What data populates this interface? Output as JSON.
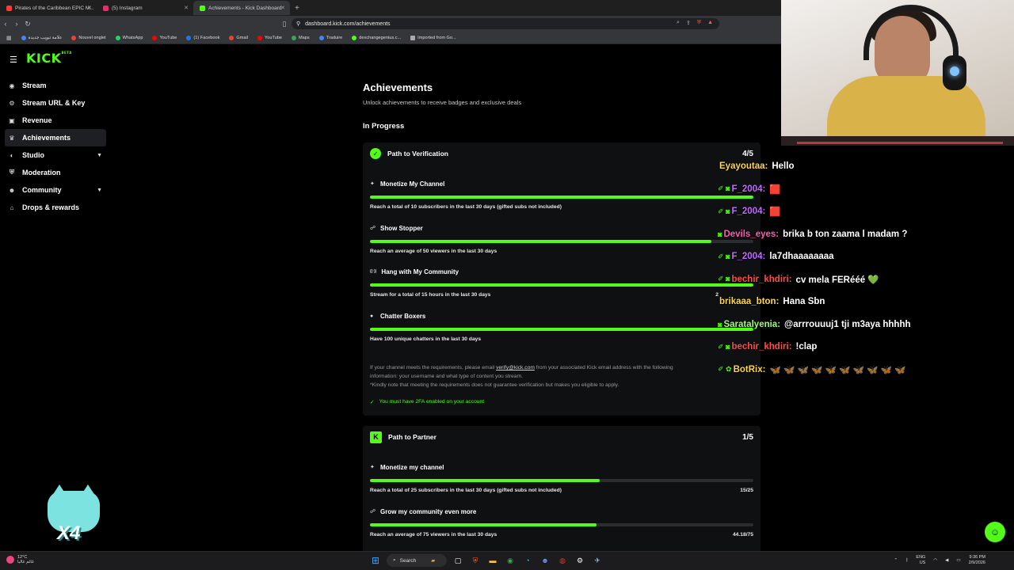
{
  "browser": {
    "tabs": [
      {
        "title": "Pirates of the Caribbean EPIC M...",
        "color": "#ff3b30"
      },
      {
        "title": "(5) Instagram",
        "color": "#e1306c"
      },
      {
        "title": "Achievements - Kick Dashboard",
        "color": "#53fc18"
      }
    ],
    "url": "dashboard.kick.com/achievements",
    "bookmarks": [
      {
        "label": "علامة تبويب جديدة",
        "color": "#4285f4"
      },
      {
        "label": "Nouvel onglet",
        "color": "#ea4335"
      },
      {
        "label": "WhatsApp",
        "color": "#25d366"
      },
      {
        "label": "YouTube",
        "color": "#ff0000"
      },
      {
        "label": "(1) Facebook",
        "color": "#1877f2"
      },
      {
        "label": "Gmail",
        "color": "#ea4335"
      },
      {
        "label": "YouTube",
        "color": "#ff0000"
      },
      {
        "label": "Maps",
        "color": "#34a853"
      },
      {
        "label": "Traduire",
        "color": "#4285f4"
      },
      {
        "label": "dexchangegenius.c...",
        "color": "#53fc18"
      },
      {
        "label": "Imported from Go...",
        "color": "#aaaaaa"
      }
    ]
  },
  "sidebar": {
    "logo": "KICK",
    "logo_tag": "BETA",
    "items": [
      {
        "label": "Stream",
        "icon": "broadcast-icon",
        "glyph": "◉",
        "active": false,
        "chevron": false
      },
      {
        "label": "Stream URL & Key",
        "icon": "key-icon",
        "glyph": "⚙",
        "active": false,
        "chevron": false
      },
      {
        "label": "Revenue",
        "icon": "revenue-icon",
        "glyph": "▣",
        "active": false,
        "chevron": false
      },
      {
        "label": "Achievements",
        "icon": "trophy-icon",
        "glyph": "♛",
        "active": true,
        "chevron": false
      },
      {
        "label": "Studio",
        "icon": "studio-icon",
        "glyph": "◐",
        "active": false,
        "chevron": true
      },
      {
        "label": "Moderation",
        "icon": "shield-icon",
        "glyph": "⛨",
        "active": false,
        "chevron": false
      },
      {
        "label": "Community",
        "icon": "community-icon",
        "glyph": "☻",
        "active": false,
        "chevron": true
      },
      {
        "label": "Drops & rewards",
        "icon": "gift-icon",
        "glyph": "⌂",
        "active": false,
        "chevron": false
      }
    ]
  },
  "main": {
    "title": "Achievements",
    "subtitle": "Unlock achievements to receive badges and exclusive deals",
    "section": "In Progress",
    "verification": {
      "title": "Path to Verification",
      "count": "4/5",
      "items": [
        {
          "name": "Monetize My Channel",
          "icon": "sparkle-icon",
          "glyph": "✦",
          "desc": "Reach a total of 10 subscribers in the last 30 days (gifted subs not included)",
          "progress": 1.0,
          "value": ""
        },
        {
          "name": "Show Stopper",
          "icon": "users-icon",
          "glyph": "☍",
          "desc": "Reach an average of 50 viewers in the last 30 days",
          "progress": 0.89,
          "value": ""
        },
        {
          "name": "Hang with My Community",
          "icon": "signal-icon",
          "glyph": "((·))",
          "desc": "Stream for a total of 15 hours in the last 30 days",
          "progress": 1.0,
          "value": "2"
        },
        {
          "name": "Chatter Boxers",
          "icon": "chat-icon",
          "glyph": "●",
          "desc": "Have 100 unique chatters in the last 30 days",
          "progress": 1.0,
          "value": ""
        }
      ],
      "info_prefix": "If your channel meets the requirements, please email ",
      "info_email": "verify@kick.com",
      "info_suffix": " from your associated Kick email address with the following",
      "info_line2": "information: your username and what type of content you stream.",
      "info_line3": "*Kindly note that meeting the requirements does not guarantee verification but makes you eligible to apply.",
      "twofa": "You must have 2FA enabled on your account"
    },
    "partner": {
      "title": "Path to Partner",
      "count": "1/5",
      "items": [
        {
          "name": "Monetize my channel",
          "icon": "sparkle-icon",
          "glyph": "✦",
          "desc": "Reach a total of 25 subscribers in the last 30 days (gifted subs not included)",
          "progress": 0.6,
          "value": "15/25"
        },
        {
          "name": "Grow my community even more",
          "icon": "users-icon",
          "glyph": "☍",
          "desc": "Reach an average of 75 viewers in the last 30 days",
          "progress": 0.59,
          "value": "44.18/75"
        }
      ]
    }
  },
  "chat": [
    {
      "badges": "",
      "user": "Eyayoutaa:",
      "color": "#ffd84a",
      "text": "Hello"
    },
    {
      "badges": "✐ ◙",
      "user": "F_2004:",
      "color": "#c36bff",
      "text": "🟥"
    },
    {
      "badges": "✐ ◙",
      "user": "F_2004:",
      "color": "#c36bff",
      "text": "🟥"
    },
    {
      "badges": "◙",
      "user": "Devils_eyes:",
      "color": "#ff5ab4",
      "text": "brika b ton zaama l madam ?"
    },
    {
      "badges": "✐ ◙",
      "user": "F_2004:",
      "color": "#c36bff",
      "text": "la7dhaaaaaaaa"
    },
    {
      "badges": "✐ ◙",
      "user": "bechir_khdiri:",
      "color": "#ff4d4d",
      "text": "cv mela FERééé 💚"
    },
    {
      "badges": "",
      "user": "brikaaa_bton:",
      "color": "#ffd84a",
      "text": "Hana Sbn"
    },
    {
      "badges": "◙",
      "user": "Saratalyenia:",
      "color": "#9dff6b",
      "text": "@arrrouuuj1 tji m3aya hhhhh"
    },
    {
      "badges": "✐ ◙",
      "user": "bechir_khdiri:",
      "color": "#ff4d4d",
      "text": "!clap"
    },
    {
      "badges": "✐ ✿",
      "user": "BotRix:",
      "color": "#ffd84a",
      "text": "🦋 🦋 🦋 🦋 🦋 🦋 🦋 🦋 🦋 🦋"
    }
  ],
  "sticker": {
    "label": "X4"
  },
  "taskbar": {
    "weather_temp": "12°C",
    "weather_desc": "غائم غالبا",
    "search": "Search",
    "lang": "ENG",
    "region": "US",
    "time": "9:36 PM",
    "date": "2/9/2026"
  }
}
